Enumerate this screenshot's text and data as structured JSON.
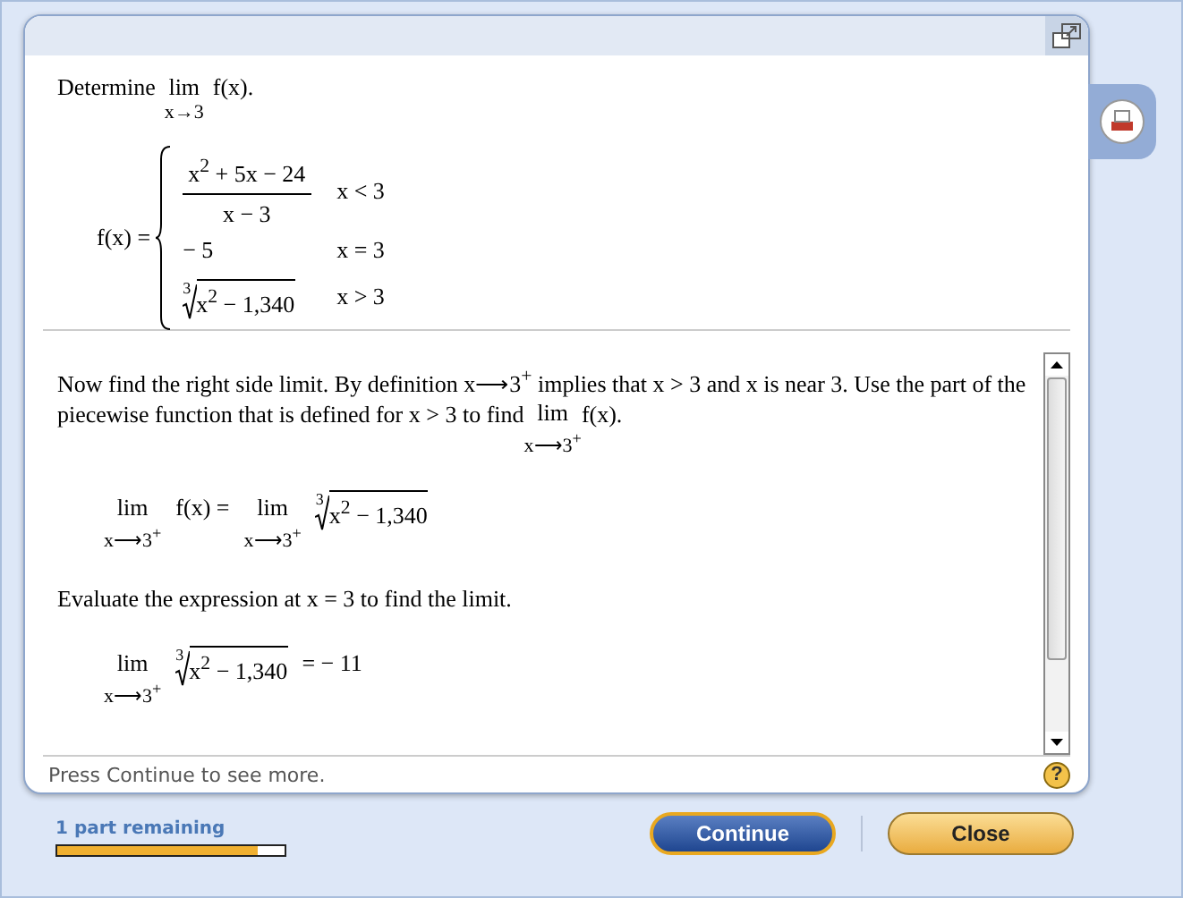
{
  "problem": {
    "prompt": "Determine",
    "lim": {
      "word": "lim",
      "sub": "x→3"
    },
    "func": "f(x)."
  },
  "piecewise": {
    "lhs": "f(x) =",
    "cases": [
      {
        "kind": "fraction",
        "num": "x$^{2}$ + 5x − 24",
        "den": "x − 3",
        "cond": "x < 3"
      },
      {
        "kind": "plain",
        "expr": "− 5",
        "cond": "x = 3"
      },
      {
        "kind": "root",
        "index": "3",
        "radicand": "x$^{2}$ − 1,340",
        "cond": "x > 3"
      }
    ]
  },
  "step": {
    "paragraph": "Now find the right side limit. By definition x⟶3$^{+}$ implies that x > 3 and x is near 3. Use the part of the piecewise function that is defined for x > 3 to find",
    "lim": {
      "word": "lim",
      "sub": "x⟶3$^{+}$"
    },
    "func": "f(x).",
    "equation_1": [
      {
        "kind": "lim",
        "word": "lim",
        "sub": "x⟶3$^{+}$"
      },
      {
        "kind": "text",
        "text": "f(x) ="
      },
      {
        "kind": "lim",
        "word": "lim",
        "sub": "x⟶3$^{+}$"
      },
      {
        "kind": "root",
        "index": "3",
        "radicand": "x$^{2}$ − 1,340"
      }
    ],
    "paragraph_2": "Evaluate the expression at x = 3 to find the limit.",
    "equation_2": [
      {
        "kind": "lim",
        "word": "lim",
        "sub": "x⟶3$^{+}$"
      },
      {
        "kind": "root",
        "index": "3",
        "radicand": "x$^{2}$ − 1,340"
      },
      {
        "kind": "text",
        "text": "= − 11"
      }
    ]
  },
  "hint": "Press Continue to see more.",
  "help": "?",
  "progress": {
    "label": "1 part remaining",
    "level": 0.88
  },
  "buttons": [
    {
      "kind": "primary",
      "label": "Continue"
    },
    {
      "kind": "secondary",
      "label": "Close"
    }
  ]
}
